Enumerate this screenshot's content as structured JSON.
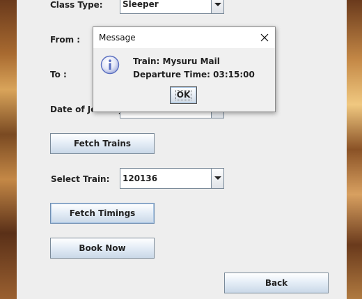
{
  "form": {
    "class_type_label": "Class Type:",
    "class_type_value": "Sleeper",
    "from_label": "From :",
    "to_label": "To :",
    "date_label": "Date of Journey",
    "fetch_trains_label": "Fetch Trains",
    "select_train_label": "Select Train:",
    "select_train_value": "120136",
    "fetch_timings_label": "Fetch Timings",
    "book_now_label": "Book Now",
    "back_label": "Back"
  },
  "dialog": {
    "title": "Message",
    "line1": "Train: Mysuru Mail",
    "line2": "Departure Time: 03:15:00",
    "ok_label": "OK"
  },
  "colors": {
    "panel_bg": "#eeeeee",
    "dialog_bg": "#f0f0f0",
    "info_icon": "#5a6fc0"
  }
}
